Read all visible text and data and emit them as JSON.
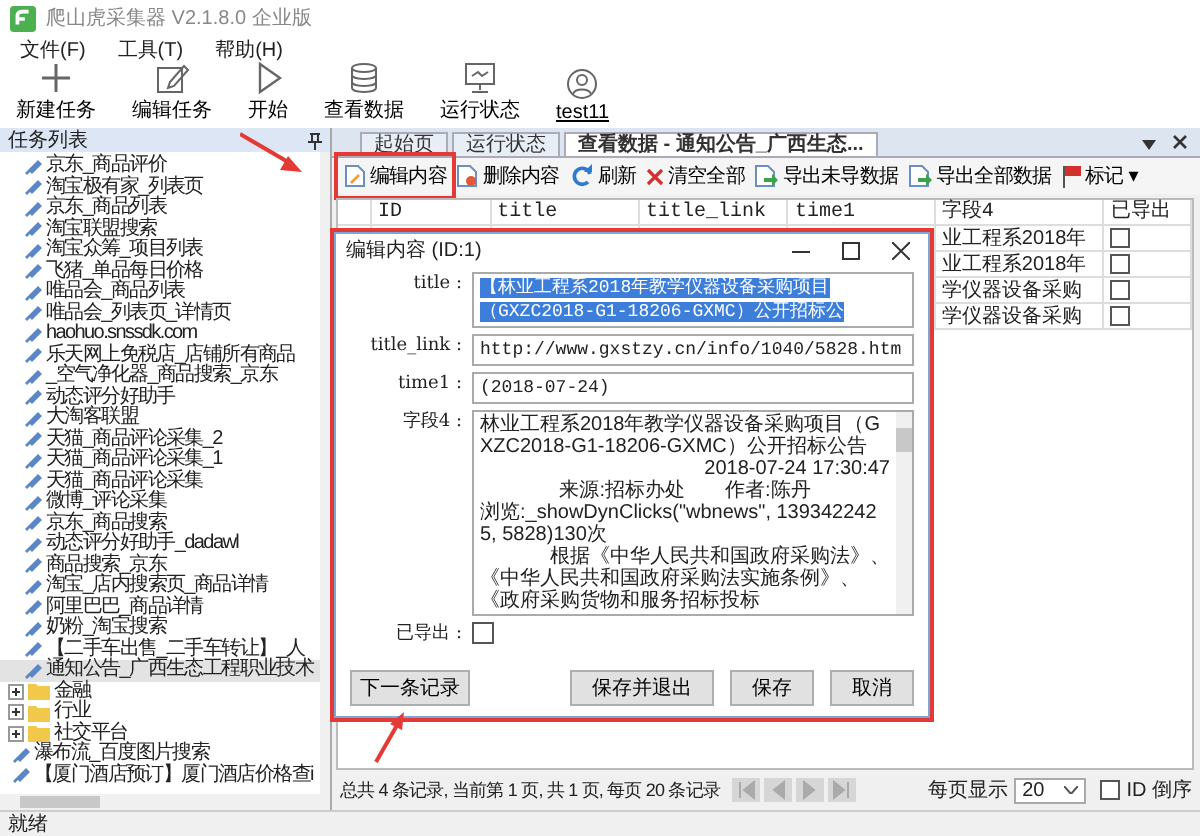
{
  "window": {
    "title": "爬山虎采集器 V2.1.8.0 企业版"
  },
  "menu": [
    "文件(F)",
    "工具(T)",
    "帮助(H)"
  ],
  "toolbar": [
    {
      "kind": "new",
      "label": "新建任务"
    },
    {
      "kind": "edit",
      "label": "编辑任务"
    },
    {
      "kind": "start",
      "label": "开始"
    },
    {
      "kind": "data",
      "label": "查看数据"
    },
    {
      "kind": "monitor",
      "label": "运行状态"
    },
    {
      "kind": "user",
      "label": "test11"
    }
  ],
  "task_panel": {
    "title": "任务列表",
    "continued_items": [
      {
        "label": "京东_商品评价",
        "selected": false
      },
      {
        "label": "淘宝极有家_列表页",
        "selected": false
      },
      {
        "label": "京东_商品列表",
        "selected": false
      },
      {
        "label": "淘宝联盟搜索",
        "selected": false
      },
      {
        "label": "淘宝众筹_项目列表",
        "selected": false
      },
      {
        "label": "飞猪_单品每日价格",
        "selected": false
      },
      {
        "label": "唯品会_商品列表",
        "selected": false
      },
      {
        "label": "唯品会_列表页_详情页",
        "selected": false
      },
      {
        "label": "haohuo.snssdk.com",
        "selected": false
      },
      {
        "label": "乐天网上免税店_店铺所有商品",
        "selected": false
      },
      {
        "label": "_空气净化器_商品搜索_京东",
        "selected": false
      },
      {
        "label": "动态评分好助手",
        "selected": false
      },
      {
        "label": "大淘客联盟",
        "selected": false
      },
      {
        "label": "天猫_商品评论采集_2",
        "selected": false
      },
      {
        "label": "天猫_商品评论采集_1",
        "selected": false
      },
      {
        "label": "天猫_商品评论采集",
        "selected": false
      },
      {
        "label": "微博_评论采集",
        "selected": false
      },
      {
        "label": "京东_商品搜索",
        "selected": false
      },
      {
        "label": "动态评分好助手_dadawl",
        "selected": false
      },
      {
        "label": "商品搜索_京东",
        "selected": false
      },
      {
        "label": "淘宝_店内搜索页_商品详情",
        "selected": false
      },
      {
        "label": "阿里巴巴_商品详情",
        "selected": false
      },
      {
        "label": "奶粉_淘宝搜索",
        "selected": false
      },
      {
        "label": "【二手车出售_二手车转让】_人",
        "selected": false
      },
      {
        "label": "通知公告_广西生态工程职业技术",
        "selected": true
      }
    ],
    "items": [
      {
        "kind": "folder",
        "label": "金融",
        "expanded": false
      },
      {
        "kind": "folder",
        "label": "行业",
        "expanded": false
      },
      {
        "kind": "folder",
        "label": "社交平台",
        "expanded": false
      },
      {
        "kind": "task",
        "label": "瀑布流_百度图片搜索",
        "selected": false
      },
      {
        "kind": "task",
        "label": "【厦门酒店预订】厦门酒店价格查i",
        "selected": false
      }
    ]
  },
  "tabs": [
    {
      "label": "起始页",
      "selected": false
    },
    {
      "label": "运行状态",
      "selected": false
    },
    {
      "label": "查看数据 - 通知公告_广西生态...",
      "selected": true
    }
  ],
  "data_toolbar": [
    {
      "kind": "edit",
      "label": "编辑内容",
      "highlighted": true
    },
    {
      "kind": "delete",
      "label": "删除内容",
      "highlighted": false
    },
    {
      "kind": "refresh",
      "label": "刷新",
      "highlighted": false
    },
    {
      "kind": "clear",
      "label": "清空全部",
      "highlighted": false
    },
    {
      "kind": "export",
      "label": "导出未导数据",
      "highlighted": false
    },
    {
      "kind": "export",
      "label": "导出全部数据",
      "highlighted": false
    },
    {
      "kind": "flag",
      "label": "标记 ▾",
      "highlighted": false
    }
  ],
  "table": {
    "columns": [
      "ID",
      "title",
      "title_link",
      "time1",
      "字段4",
      "已导出"
    ],
    "rows": [
      {
        "field4": "业工程系2018年",
        "exported": false
      },
      {
        "field4": "业工程系2018年",
        "exported": false
      },
      {
        "field4": "学仪器设备采购",
        "exported": false
      },
      {
        "field4": "学仪器设备采购",
        "exported": false
      }
    ]
  },
  "dialog": {
    "title": "编辑内容 (ID:1)",
    "fields": [
      {
        "kind": "text",
        "label": "title :",
        "value": "【林业工程系2018年教学仪器设备采购项目（GXZC2018-G1-18206-GXMC）公开招标公",
        "selected": true
      },
      {
        "kind": "text",
        "label": "title_link :",
        "value": "http://www.gxstzy.cn/info/1040/5828.htm",
        "selected": false
      },
      {
        "kind": "text",
        "label": "time1 :",
        "value": "(2018-07-24)",
        "selected": false
      },
      {
        "kind": "textarea",
        "label": "字段4 :",
        "lines": [
          {
            "text": "林业工程系2018年教学仪器设备采购项目（GXZC2018-G1-18206-GXMC）公开招标公告",
            "right_aligned": false,
            "centered": false
          },
          {
            "text": "2018-07-24 17:30:47",
            "right_aligned": true,
            "centered": false
          },
          {
            "text": "来源:招标办处　　作者:陈丹",
            "right_aligned": false,
            "centered": true
          },
          {
            "text": "浏览:_showDynClicks(\"wbnews\", 1393422425, 5828)130次",
            "right_aligned": false,
            "centered": false
          },
          {
            "text": "根据《中华人民共和国政府采购法》、",
            "right_aligned": true,
            "centered": false
          },
          {
            "text": "《中华人民共和国政府采购法实施条例》、《政府采购货物和服务招标投标",
            "right_aligned": false,
            "centered": false
          }
        ]
      },
      {
        "kind": "checkbox",
        "label": "已导出 :",
        "checked": false
      }
    ],
    "buttons": [
      "下一条记录",
      "保存并退出",
      "保存",
      "取消"
    ]
  },
  "pagination": {
    "summary": "总共 4 条记录, 当前第 1 页, 共 1 页, 每页 20 条记录",
    "nav_buttons": [
      {
        "kind": "first",
        "disabled": true
      },
      {
        "kind": "prev",
        "disabled": true
      },
      {
        "kind": "next",
        "disabled": true
      },
      {
        "kind": "last",
        "disabled": true
      }
    ],
    "page_size_label": "每页显示",
    "page_size": "20",
    "id_desc": {
      "label": "ID 倒序",
      "checked": false
    }
  },
  "status_bar": "就绪"
}
